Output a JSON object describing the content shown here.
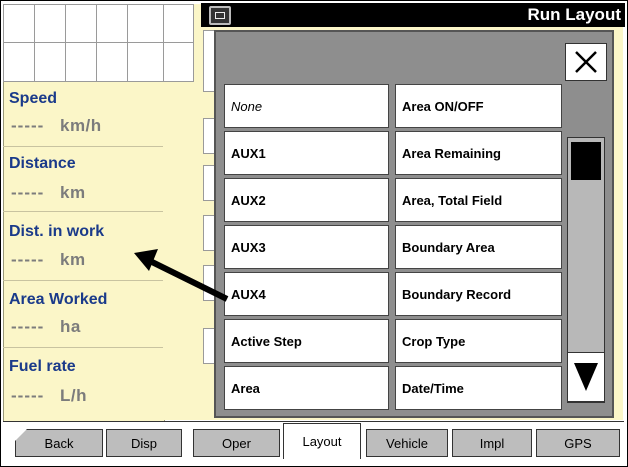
{
  "header": {
    "title": "Run Layout"
  },
  "metrics": [
    {
      "label": "Speed",
      "value": "-----",
      "unit": "km/h"
    },
    {
      "label": "Distance",
      "value": "-----",
      "unit": "km"
    },
    {
      "label": "Dist. in work",
      "value": "-----",
      "unit": "km"
    },
    {
      "label": "Area Worked",
      "value": "-----",
      "unit": "ha"
    },
    {
      "label": "Fuel rate",
      "value": "-----",
      "unit": "L/h"
    }
  ],
  "popup": {
    "close_icon": "close-icon",
    "left_options": [
      "None",
      "AUX1",
      "AUX2",
      "AUX3",
      "AUX4",
      "Active Step",
      "Area"
    ],
    "right_options": [
      "Area ON/OFF",
      "Area Remaining",
      "Area, Total Field",
      "Boundary Area",
      "Boundary Record",
      "Crop Type",
      "Date/Time"
    ],
    "scroll_down_icon": "triangle-down-icon"
  },
  "tabs": [
    "Back",
    "Disp",
    "Oper",
    "Layout",
    "Vehicle",
    "Impl",
    "GPS"
  ],
  "active_tab": "Layout",
  "colors": {
    "panel": "#fbf6c8",
    "label": "#1a3a8a",
    "popup": "#8e8e8e"
  }
}
